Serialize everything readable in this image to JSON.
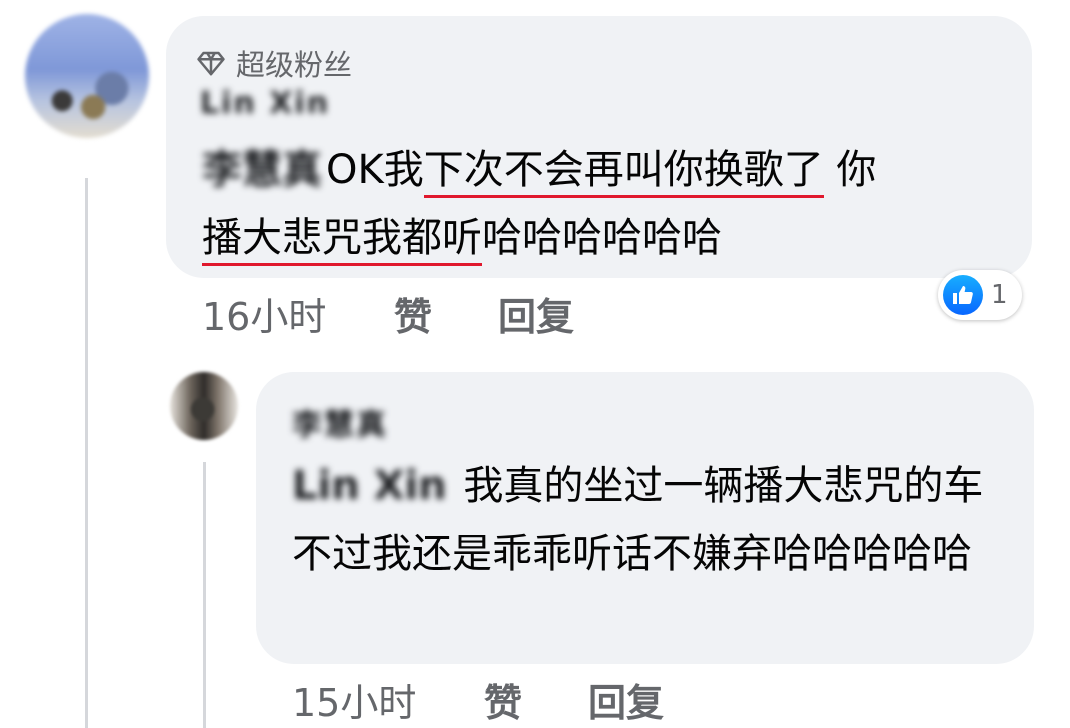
{
  "comment": {
    "badge": "超级粉丝",
    "author": "Lin Xin",
    "mention": "李慧真",
    "text_plain_1": "OK我",
    "text_underlined_1": "下次不会再叫你换歌了",
    "text_plain_2": " 你",
    "text_underlined_2": "播大悲咒我都听",
    "text_plain_3": "哈哈哈哈哈哈",
    "time": "16小时",
    "like_label": "赞",
    "reply_label": "回复",
    "reaction_count": "1"
  },
  "reply": {
    "author": "李慧真",
    "mention": "Lin Xin",
    "text": " 我真的坐过一辆播大悲咒的车 不过我还是乖乖听话不嫌弃哈哈哈哈哈",
    "time": "15小时",
    "like_label": "赞",
    "reply_label": "回复"
  },
  "colors": {
    "bubble": "#f0f2f5",
    "meta_text": "#65676b",
    "underline": "#e0182d",
    "like_blue": "#0866ff"
  },
  "icons": {
    "badge": "diamond-icon",
    "reaction": "thumbs-up-icon"
  }
}
